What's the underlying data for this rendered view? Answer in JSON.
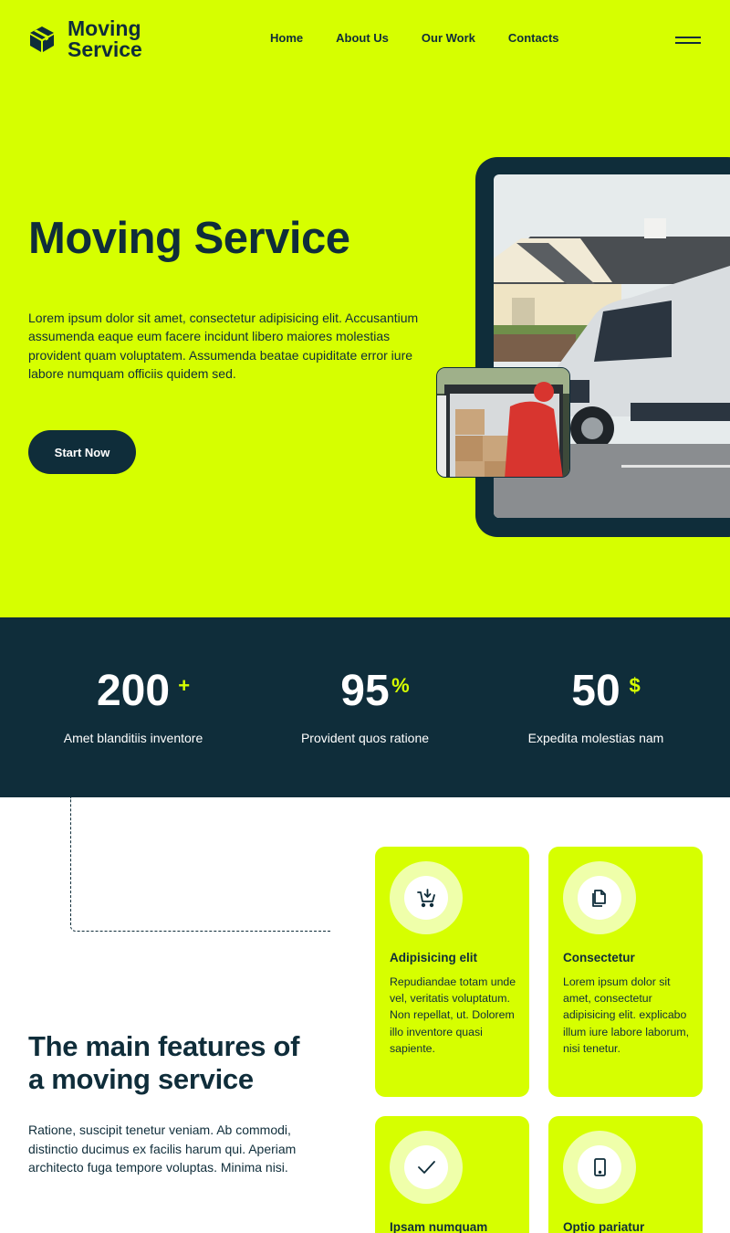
{
  "brand": {
    "name_line1": "Moving",
    "name_line2": "Service"
  },
  "nav": {
    "items": [
      "Home",
      "About Us",
      "Our Work",
      "Contacts"
    ]
  },
  "hero": {
    "title": "Moving Service",
    "text": "Lorem ipsum dolor sit amet, consectetur adipisicing elit. Accusantium assumenda eaque eum facere incidunt libero maiores molestias provident quam voluptatem. Assumenda beatae cupiditate error iure labore numquam officiis quidem sed.",
    "button": "Start Now"
  },
  "stats": [
    {
      "value": "200",
      "suffix": "+",
      "label": "Amet blanditiis inventore"
    },
    {
      "value": "95",
      "suffix": "%",
      "label": "Provident quos ratione"
    },
    {
      "value": "50",
      "suffix": "$",
      "label": "Expedita molestias nam"
    }
  ],
  "features": {
    "title": "The main features of a moving service",
    "text": "Ratione, suscipit tenetur veniam. Ab commodi, distinctio ducimus ex facilis harum qui. Aperiam architecto fuga tempore voluptas. Minima nisi.",
    "cards": [
      {
        "icon": "cart-download-icon",
        "title": "Adipisicing elit",
        "text": "Repudiandae totam unde vel, veritatis voluptatum. Non repellat, ut. Dolorem illo inventore quasi sapiente."
      },
      {
        "icon": "document-copy-icon",
        "title": "Consectetur",
        "text": "Lorem ipsum dolor sit amet, consectetur adipisicing elit. explicabo illum iure labore laborum, nisi tenetur."
      },
      {
        "icon": "checkmark-icon",
        "title": "Ipsam numquam",
        "text": ""
      },
      {
        "icon": "mobile-phone-icon",
        "title": "Optio pariatur",
        "text": ""
      }
    ]
  },
  "colors": {
    "accent": "#d6ff00",
    "dark": "#0f2d3a",
    "icon_ring": "#efffaa"
  }
}
